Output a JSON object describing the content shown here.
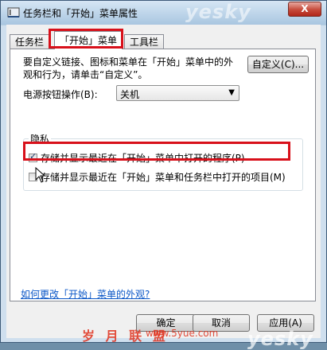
{
  "window": {
    "title": "任务栏和「开始」菜单属性",
    "close_label": "X",
    "watermark": "yesky"
  },
  "tabs": [
    {
      "label": "任务栏"
    },
    {
      "label": "「开始」菜单",
      "active": true
    },
    {
      "label": "工具栏"
    }
  ],
  "start_menu": {
    "description": "要自定义链接、图标和菜单在「开始」菜单中的外观和行为，请单击“自定义”。",
    "customize_label": "自定义(C)...",
    "power_label": "电源按钮操作(B):",
    "power_value": "关机"
  },
  "privacy": {
    "title": "隐私",
    "items": [
      {
        "label": "存储并显示最近在「开始」菜单中打开的程序(P)",
        "checked": true
      },
      {
        "label": "存储并显示最近在「开始」菜单和任务栏中打开的项目(M)",
        "checked": false
      }
    ]
  },
  "help_link": "如何更改「开始」菜单的外观?",
  "buttons": {
    "ok": "确定",
    "cancel": "取消",
    "apply": "应用(A)"
  },
  "watermarks": {
    "footer": "岁 月 联 盟",
    "site": "www.5yue.com",
    "corner": "yesky"
  },
  "colors": {
    "highlight": "#d8101a",
    "link": "#0b57c7"
  }
}
